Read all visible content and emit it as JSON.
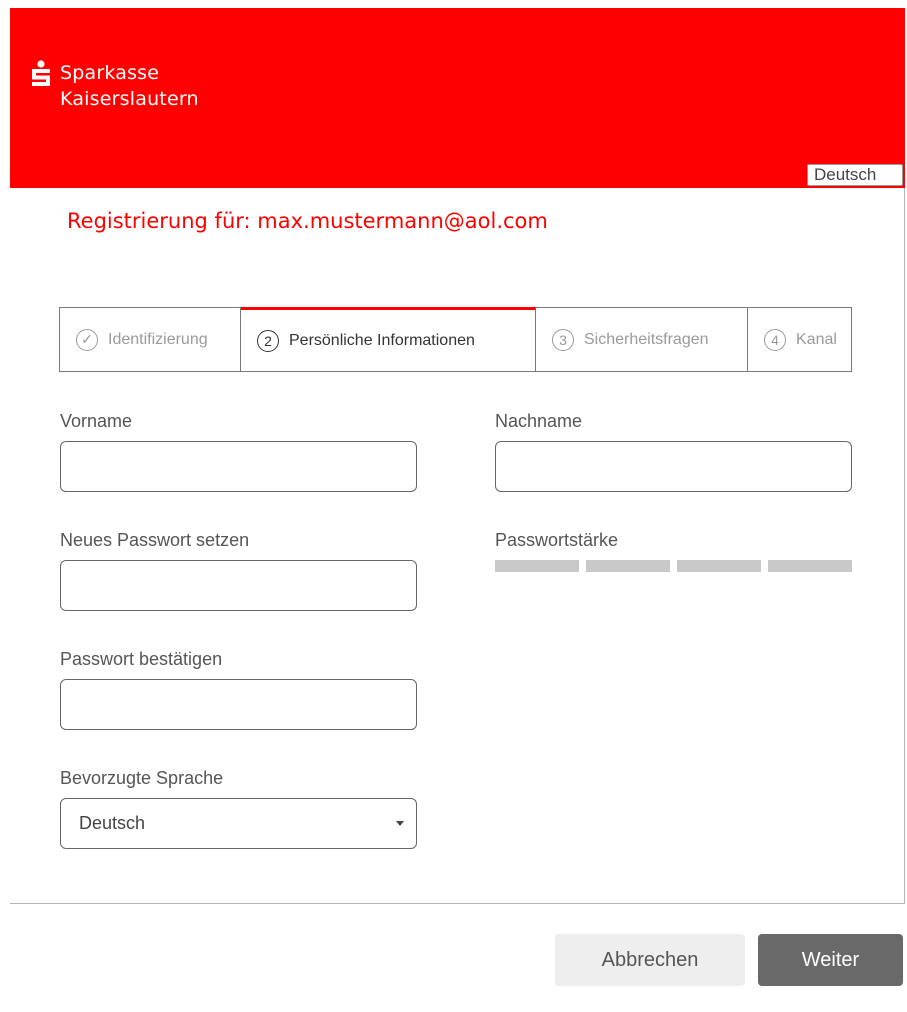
{
  "brand": {
    "line1": "Sparkasse",
    "line2": "Kaiserslautern",
    "color": "#ff0000",
    "logo_icon": "sparkasse-s-icon"
  },
  "language_button": "Deutsch",
  "registration_title": "Registrierung für: max.mustermann@aol.com",
  "steps": [
    {
      "num": "✓",
      "label": "Identifizierung",
      "state": "done"
    },
    {
      "num": "2",
      "label": "Persönliche Informationen",
      "state": "active"
    },
    {
      "num": "3",
      "label": "Sicherheitsfragen",
      "state": "pending"
    },
    {
      "num": "4",
      "label": "Kanal",
      "state": "pending"
    }
  ],
  "form": {
    "first_name_label": "Vorname",
    "first_name_value": "",
    "last_name_label": "Nachname",
    "last_name_value": "",
    "new_password_label": "Neues Passwort setzen",
    "new_password_value": "",
    "password_strength_label": "Passwortstärke",
    "password_strength_level": 0,
    "password_strength_segments": 4,
    "confirm_password_label": "Passwort bestätigen",
    "confirm_password_value": "",
    "language_label": "Bevorzugte Sprache",
    "language_value": "Deutsch"
  },
  "actions": {
    "cancel_label": "Abbrechen",
    "next_label": "Weiter"
  }
}
